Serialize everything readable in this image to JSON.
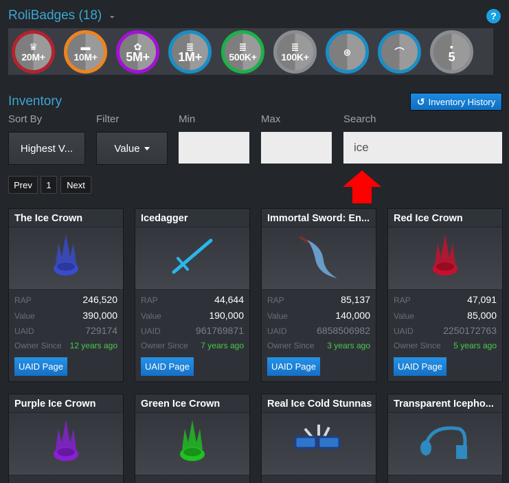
{
  "badges": {
    "title": "RoliBadges (18)",
    "items": [
      {
        "label": "20M+",
        "icon": "crown-icon",
        "glyph": "♛",
        "ring": "#b3232f"
      },
      {
        "label": "10M+",
        "icon": "chest-icon",
        "glyph": "▬",
        "ring": "#ee8420"
      },
      {
        "label": "5M+",
        "icon": "money-bag-icon",
        "glyph": "✿",
        "ring": "#a212d6"
      },
      {
        "label": "1M+",
        "icon": "coin-stacks-icon",
        "glyph": "≣",
        "ring": "#1a8ec6"
      },
      {
        "label": "500K+",
        "icon": "coin-stacks-icon",
        "glyph": "≣",
        "ring": "#1db14a"
      },
      {
        "label": "100K+",
        "icon": "coin-stack-icon",
        "glyph": "≣",
        "ring": "#8a8d92"
      },
      {
        "label": "",
        "icon": "dominus-icon",
        "glyph": "⊛",
        "ring": "#1a8ec6"
      },
      {
        "label": "",
        "icon": "sparkle-hat-icon",
        "glyph": "⌒",
        "ring": "#1a8ec6"
      },
      {
        "label": "5",
        "icon": "roblox-figure-icon",
        "glyph": "▪",
        "ring": "#8a8d92"
      }
    ]
  },
  "help_label": "?",
  "inventory": {
    "title": "Inventory",
    "history_label": "Inventory History",
    "labels": {
      "sort": "Sort By",
      "filter": "Filter",
      "min": "Min",
      "max": "Max",
      "search": "Search"
    },
    "sort_value": "Highest V...",
    "filter_value": "Value",
    "min_value": "",
    "max_value": "",
    "search_value": "ice",
    "pagination": {
      "prev": "Prev",
      "page": "1",
      "next": "Next"
    }
  },
  "stat_labels": {
    "rap": "RAP",
    "value": "Value",
    "uaid": "UAID",
    "owner": "Owner Since",
    "button": "UAID Page"
  },
  "items": [
    {
      "name": "The Ice Crown",
      "rap": "246,520",
      "value": "390,000",
      "uaid": "729174",
      "owner_since": "12 years ago",
      "color": "#3a4bd0",
      "kind": "crown"
    },
    {
      "name": "Icedagger",
      "rap": "44,644",
      "value": "190,000",
      "uaid": "961769871",
      "owner_since": "7 years ago",
      "color": "#2ab6ea",
      "kind": "sword"
    },
    {
      "name": "Immortal Sword: En...",
      "rap": "85,137",
      "value": "140,000",
      "uaid": "6858506982",
      "owner_since": "3 years ago",
      "color": "#6a9cc8",
      "kind": "blade"
    },
    {
      "name": "Red Ice Crown",
      "rap": "47,091",
      "value": "85,000",
      "uaid": "2250172763",
      "owner_since": "5 years ago",
      "color": "#c8102e",
      "kind": "crown"
    },
    {
      "name": "Purple Ice Crown",
      "color": "#8a1fd6",
      "kind": "crown"
    },
    {
      "name": "Green Ice Crown",
      "color": "#1fc21f",
      "kind": "crown"
    },
    {
      "name": "Real Ice Cold Stunnas",
      "color": "#2e76c9",
      "kind": "glasses"
    },
    {
      "name": "Transparent Icepho...",
      "color": "#2e8ac0",
      "kind": "headphones"
    }
  ]
}
